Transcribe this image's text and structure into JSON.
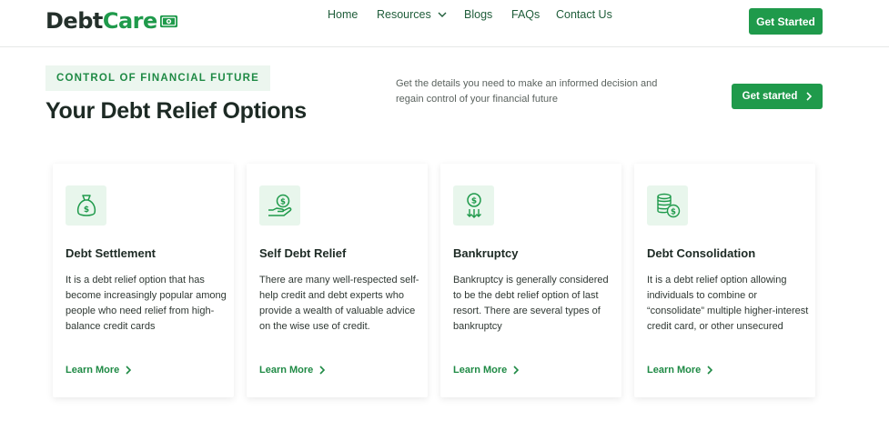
{
  "brand": {
    "part1": "Debt",
    "part2": "Care",
    "accent": "#1f9a4b",
    "logo_icon": "dollar-bill-icon"
  },
  "nav": {
    "home": "Home",
    "resources": "Resources",
    "blogs": "Blogs",
    "faqs": "FAQs",
    "contact": "Contact Us",
    "cta": "Get Started"
  },
  "hero": {
    "eyebrow": "CONTROL OF FINANCIAL FUTURE",
    "title": "Your Debt Relief Options",
    "description": "Get the details you need to make an informed decision and regain control of your financial future",
    "cta": "Get started"
  },
  "cards": [
    {
      "icon": "money-bag-icon",
      "title": "Debt Settlement",
      "text": "It is a debt relief option that has become increasingly popular among people who need relief from high-balance credit cards",
      "link": "Learn More"
    },
    {
      "icon": "hand-coin-icon",
      "title": "Self Debt Relief",
      "text": "There are many well-respected self-help credit and debt experts who provide a wealth of valuable advice on the wise use of credit.",
      "link": "Learn More"
    },
    {
      "icon": "dollar-arrows-icon",
      "title": "Bankruptcy",
      "text": "Bankruptcy is generally considered to be the debt relief option of last resort. There are several types of bankruptcy",
      "link": "Learn More"
    },
    {
      "icon": "coin-stack-icon",
      "title": "Debt Consolidation",
      "text": "It is a debt relief option allowing individuals to combine or “consolidate” multiple higher-interest credit card, or other unsecured",
      "link": "Learn More"
    }
  ]
}
